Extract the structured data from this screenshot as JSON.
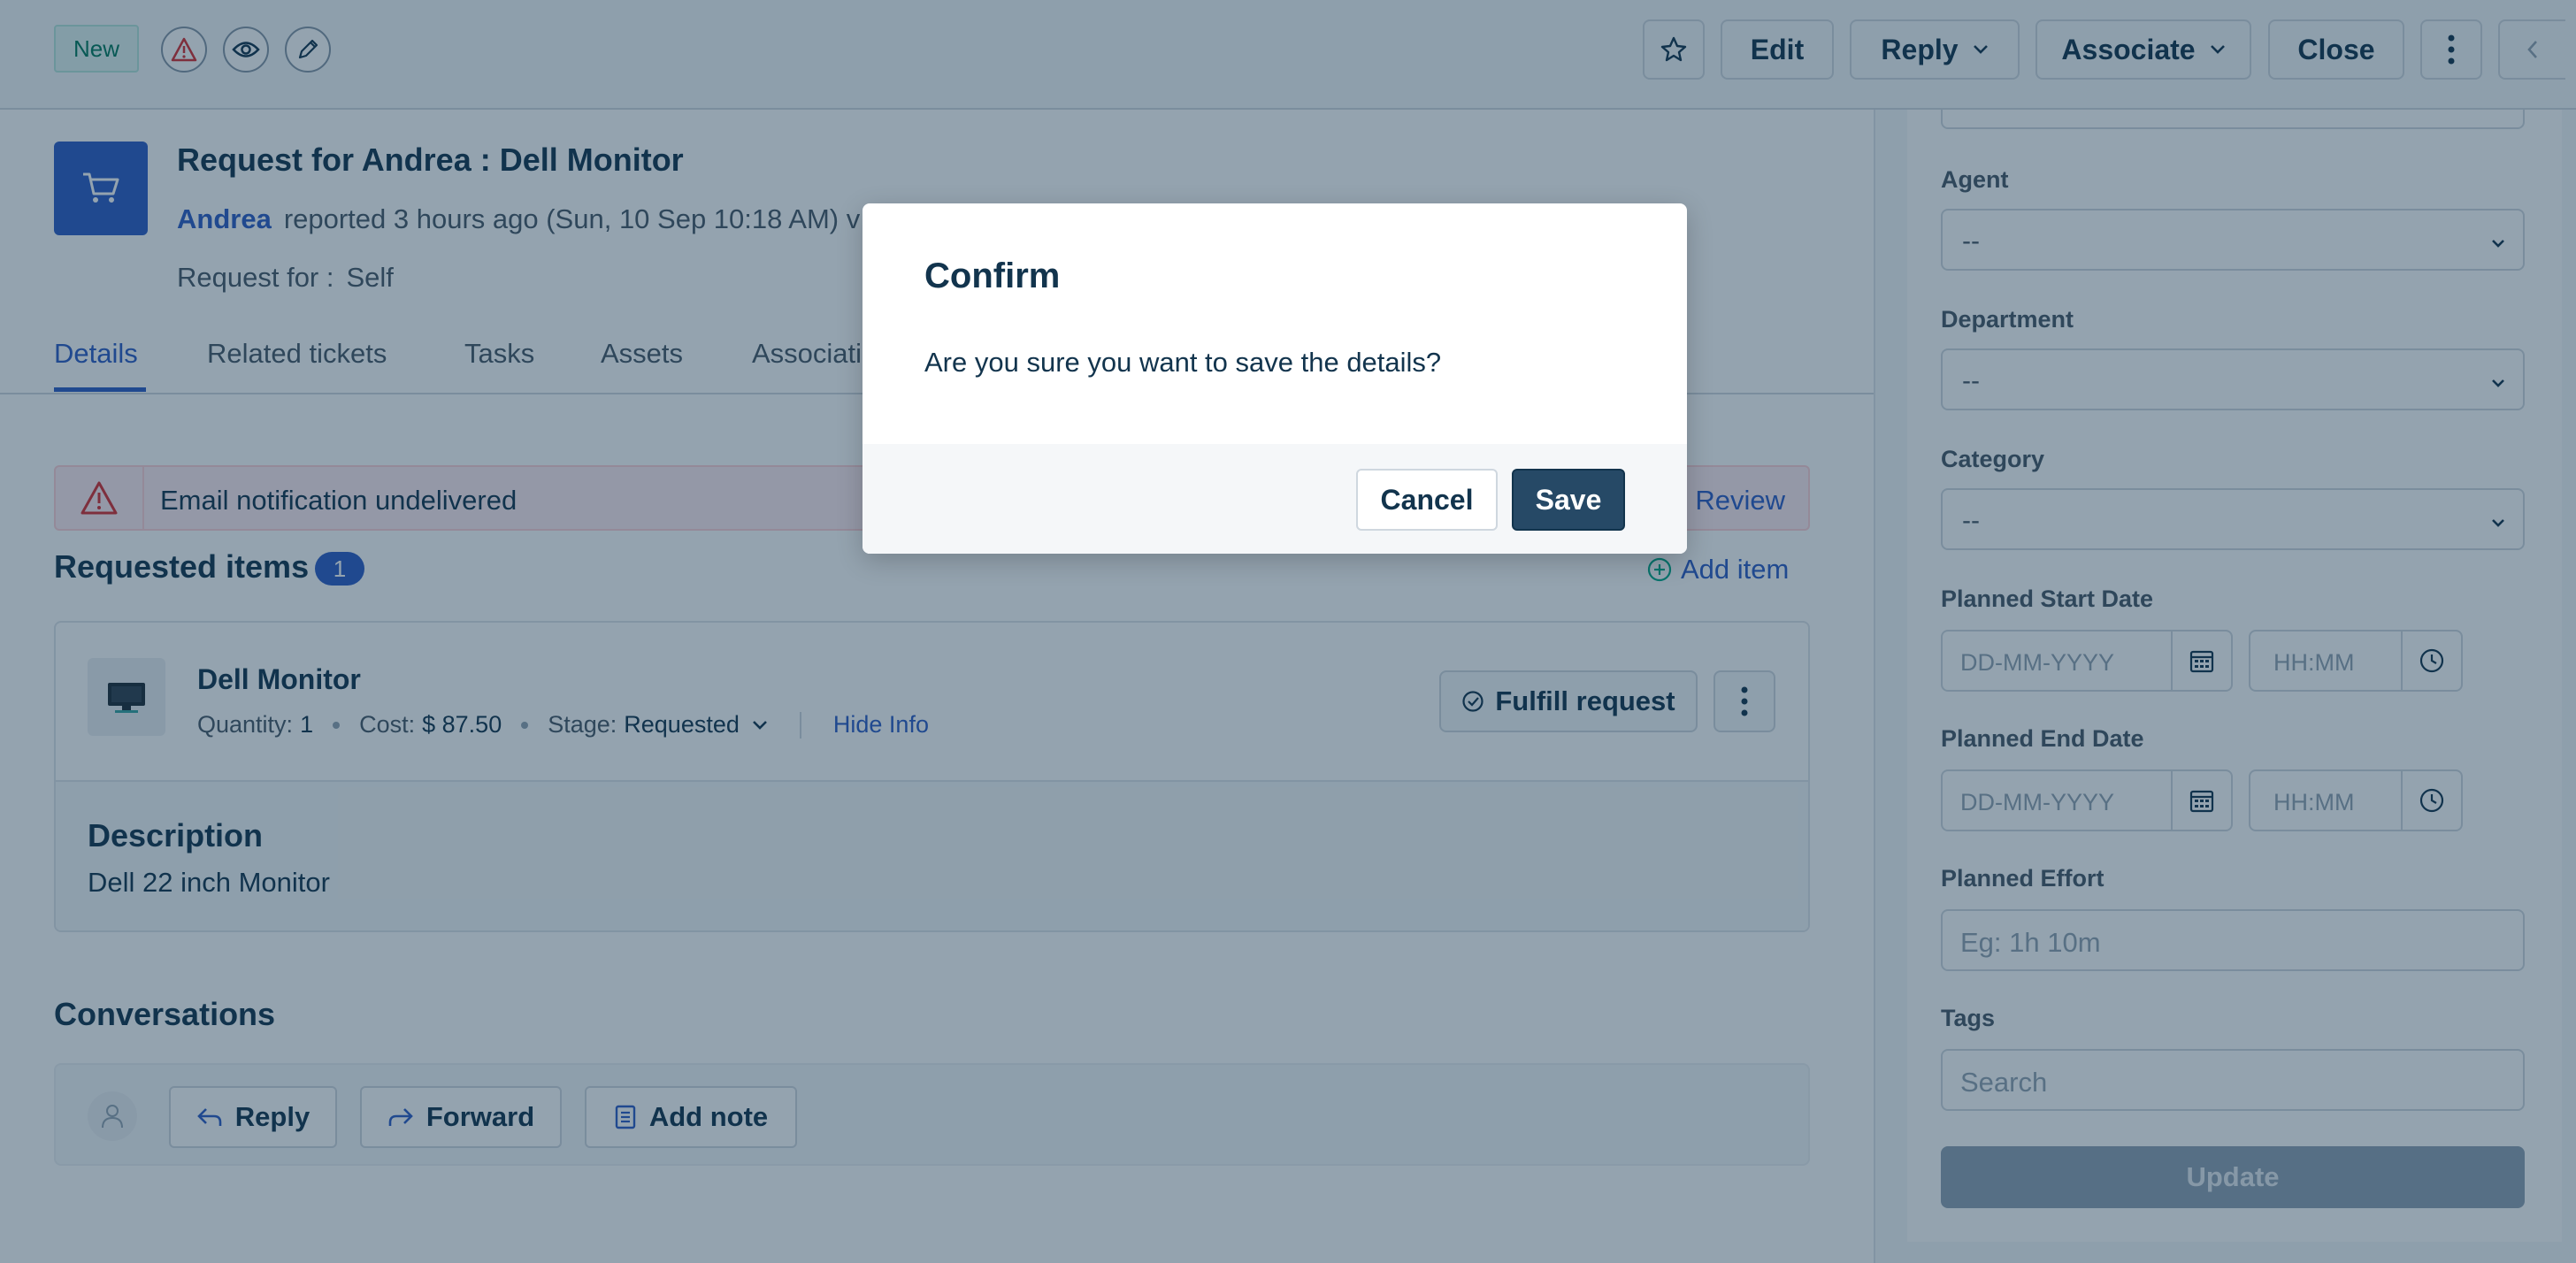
{
  "topbar": {
    "status_badge": "New",
    "buttons": {
      "edit": "Edit",
      "reply": "Reply",
      "associate": "Associate",
      "close": "Close"
    }
  },
  "request": {
    "title": "Request for Andrea : Dell Monitor",
    "requester": "Andrea",
    "reported_text": "reported 3 hours ago (Sun, 10 Sep 10:18 AM) v",
    "request_for_label": "Request for :",
    "request_for_value": "Self"
  },
  "tabs": [
    {
      "label": "Details",
      "active": true
    },
    {
      "label": "Related tickets"
    },
    {
      "label": "Tasks"
    },
    {
      "label": "Assets"
    },
    {
      "label": "Associati"
    }
  ],
  "alert": {
    "text": "Email notification undelivered",
    "link": "Review"
  },
  "requested_items": {
    "title": "Requested items",
    "count": "1",
    "add_item": "Add item",
    "item": {
      "name": "Dell Monitor",
      "quantity_label": "Quantity:",
      "quantity": "1",
      "cost_label": "Cost:",
      "cost": "$ 87.50",
      "stage_label": "Stage:",
      "stage": "Requested",
      "hide_info": "Hide Info",
      "fulfill": "Fulfill request",
      "description_title": "Description",
      "description": "Dell 22 inch Monitor"
    }
  },
  "conversations": {
    "title": "Conversations",
    "reply": "Reply",
    "forward": "Forward",
    "add_note": "Add note"
  },
  "properties": {
    "agent_label": "Agent",
    "agent_value": "--",
    "department_label": "Department",
    "department_value": "--",
    "category_label": "Category",
    "category_value": "--",
    "planned_start_label": "Planned Start Date",
    "planned_end_label": "Planned End Date",
    "date_placeholder": "DD-MM-YYYY",
    "time_placeholder": "HH:MM",
    "effort_label": "Planned Effort",
    "effort_placeholder": "Eg: 1h 10m",
    "tags_label": "Tags",
    "tags_placeholder": "Search",
    "update": "Update"
  },
  "modal": {
    "title": "Confirm",
    "message": "Are you sure you want to save the details?",
    "cancel": "Cancel",
    "save": "Save"
  },
  "colors": {
    "accent": "#2c5cc5",
    "primary_dark": "#264966",
    "danger": "#d72d30"
  }
}
